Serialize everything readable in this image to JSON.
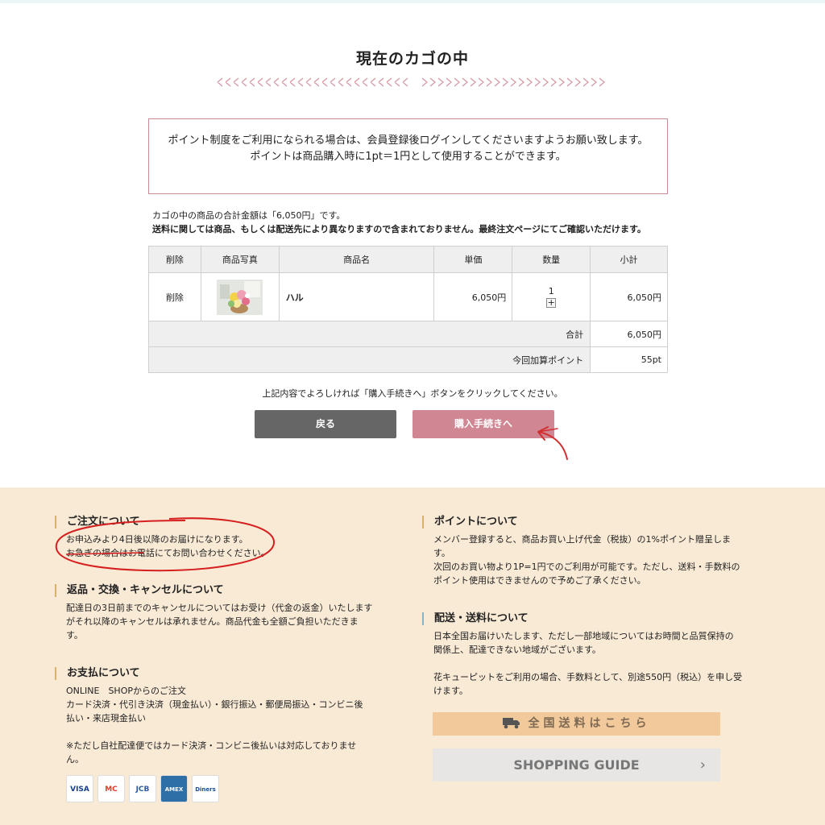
{
  "page": {
    "title": "現在のカゴの中"
  },
  "notice": {
    "line1": "ポイント制度をご利用になられる場合は、会員登録後ログインしてくださいますようお願い致します。",
    "line2": "ポイントは商品購入時に1pt＝1円として使用することができます。"
  },
  "summary": {
    "total_line": "カゴの中の商品の合計金額は「6,050円」です。",
    "shipping_line": "送料に関しては商品、もしくは配送先により異なりますので含まれておりません。最終注文ページにてご確認いただけます。"
  },
  "cart_table": {
    "headers": [
      "削除",
      "商品写真",
      "商品名",
      "単価",
      "数量",
      "小計"
    ],
    "item": {
      "delete": "削除",
      "name": "ハル",
      "price": "6,050円",
      "qty": "1",
      "plus": "+",
      "subtotal": "6,050円"
    },
    "total_label": "合計",
    "total_value": "6,050円",
    "points_label": "今回加算ポイント",
    "points_value": "55pt"
  },
  "actions": {
    "confirm_text": "上記内容でよろしければ「購入手続きへ」ボタンをクリックしてください。",
    "back_label": "戻る",
    "purchase_label": "購入手続きへ"
  },
  "footer": {
    "order": {
      "heading": "ご注文について",
      "lines": [
        "お申込みより4日後以降のお届けになります。",
        "お急ぎの場合はお電話にてお問い合わせください。"
      ]
    },
    "returns": {
      "heading": "返品・交換・キャンセルについて",
      "lines": [
        "配達日の3日前までのキャンセルについてはお受け（代金の返金）いたします",
        "がそれ以降のキャンセルは承れません。商品代金も全額ご負担いただきま",
        "す。"
      ]
    },
    "payment": {
      "heading": "お支払について",
      "lines": [
        "ONLINE　SHOPからのご注文",
        "カード決済・代引き決済（現金払い）・銀行振込・郵便局振込・コンビニ後",
        "払い・来店現金払い"
      ],
      "note_lines": [
        "※ただし自社配達便ではカード決済・コンビニ後払いは対応しておりませ",
        "ん。"
      ],
      "cards": [
        "VISA",
        "MC",
        "JCB",
        "AMEX",
        "Diners"
      ]
    },
    "points": {
      "heading": "ポイントについて",
      "lines": [
        "メンバー登録すると、商品お買い上げ代金（税抜）の1%ポイント贈呈しま",
        "す。",
        "次回のお買い物より1P=1円でのご利用が可能です。ただし、送料・手数料の",
        "ポイント使用はできませんので予めご了承ください。"
      ]
    },
    "delivery": {
      "heading": "配送・送料について",
      "lines": [
        "日本全国お届けいたします、ただし一部地域についてはお時間と品質保持の",
        "関係上、配達できない地域がございます。"
      ],
      "lines2": [
        "花キューピットをご利用の場合、手数料として、別途550円（税込）を申し受",
        "けます。"
      ]
    },
    "shipping_button": "全国送料はこちら",
    "guide_button": "SHOPPING GUIDE",
    "guide_chevron": "›"
  },
  "colors": {
    "accent_pink": "#d08793",
    "footer_bg": "#f9ead6",
    "back_button": "#666666"
  }
}
